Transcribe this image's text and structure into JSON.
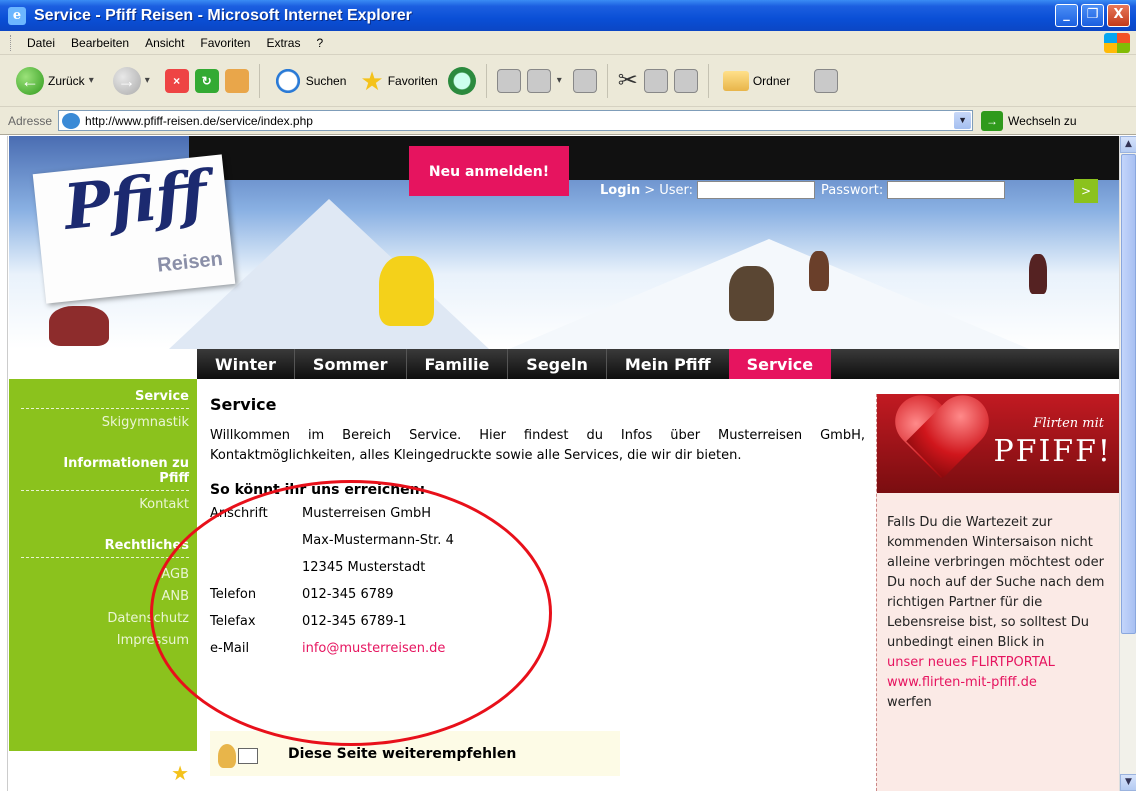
{
  "window": {
    "title": "Service - Pfiff Reisen - Microsoft Internet Explorer",
    "buttons": {
      "min": "_",
      "max": "❐",
      "close": "X"
    }
  },
  "menu": [
    "Datei",
    "Bearbeiten",
    "Ansicht",
    "Favoriten",
    "Extras",
    "?"
  ],
  "toolbar": {
    "back": "Zurück",
    "search": "Suchen",
    "favorites": "Favoriten",
    "folders": "Ordner"
  },
  "address": {
    "label": "Adresse",
    "url": "http://www.pfiff-reisen.de/service/index.php",
    "go": "Wechseln zu"
  },
  "header": {
    "logo_text": "Pfiff",
    "logo_sub": "Reisen",
    "register": "Neu anmelden!",
    "login_label": "Login",
    "user_label": " > User:",
    "password_label": "Passwort:",
    "go": ">"
  },
  "nav": [
    "Winter",
    "Sommer",
    "Familie",
    "Segeln",
    "Mein Pfiff",
    "Service"
  ],
  "sidebar": {
    "section1": "Service",
    "item_skigymnastik": "Skigymnastik",
    "section2_l1": "Informationen zu",
    "section2_l2": "Pfiff",
    "item_kontakt": "Kontakt",
    "section3": "Rechtliches",
    "item_agb": "AGB",
    "item_anb": "ANB",
    "item_datenschutz": "Datenschutz",
    "item_impressum": "Impressum"
  },
  "main": {
    "title": "Service",
    "intro": "Willkommen im Bereich Service. Hier findest du Infos über Musterreisen GmbH, Kontaktmöglichkeiten, alles Kleingedruckte sowie alle Services, die wir dir bieten.",
    "contact_heading": "So könnt ihr uns erreichen:",
    "contact": [
      {
        "k": "Anschrift",
        "v": "Musterreisen GmbH"
      },
      {
        "k": "",
        "v": "Max-Mustermann-Str. 4"
      },
      {
        "k": "",
        "v": "12345 Musterstadt"
      },
      {
        "k": "Telefon",
        "v": "012-345 6789"
      },
      {
        "k": "Telefax",
        "v": "012-345 6789-1"
      },
      {
        "k": "e-Mail",
        "v": "info@musterreisen.de"
      }
    ],
    "recommend": "Diese Seite weiterempfehlen"
  },
  "promo": {
    "flirten_mit": "Flirten mit",
    "pfiff": "PFIFF!",
    "text": "Falls Du die Wartezeit zur kommenden Wintersaison nicht alleine verbringen möchtest oder Du noch auf der Suche nach dem richtigen Partner für die Lebensreise bist, so solltest Du unbedingt einen Blick in",
    "link1": "unser neues FLIRTPORTAL",
    "link2": "www.flirten-mit-pfiff.de",
    "suffix": "werfen"
  },
  "colors": {
    "accent": "#e6145f",
    "green": "#8bc21d",
    "annotation": "#e8101a"
  }
}
